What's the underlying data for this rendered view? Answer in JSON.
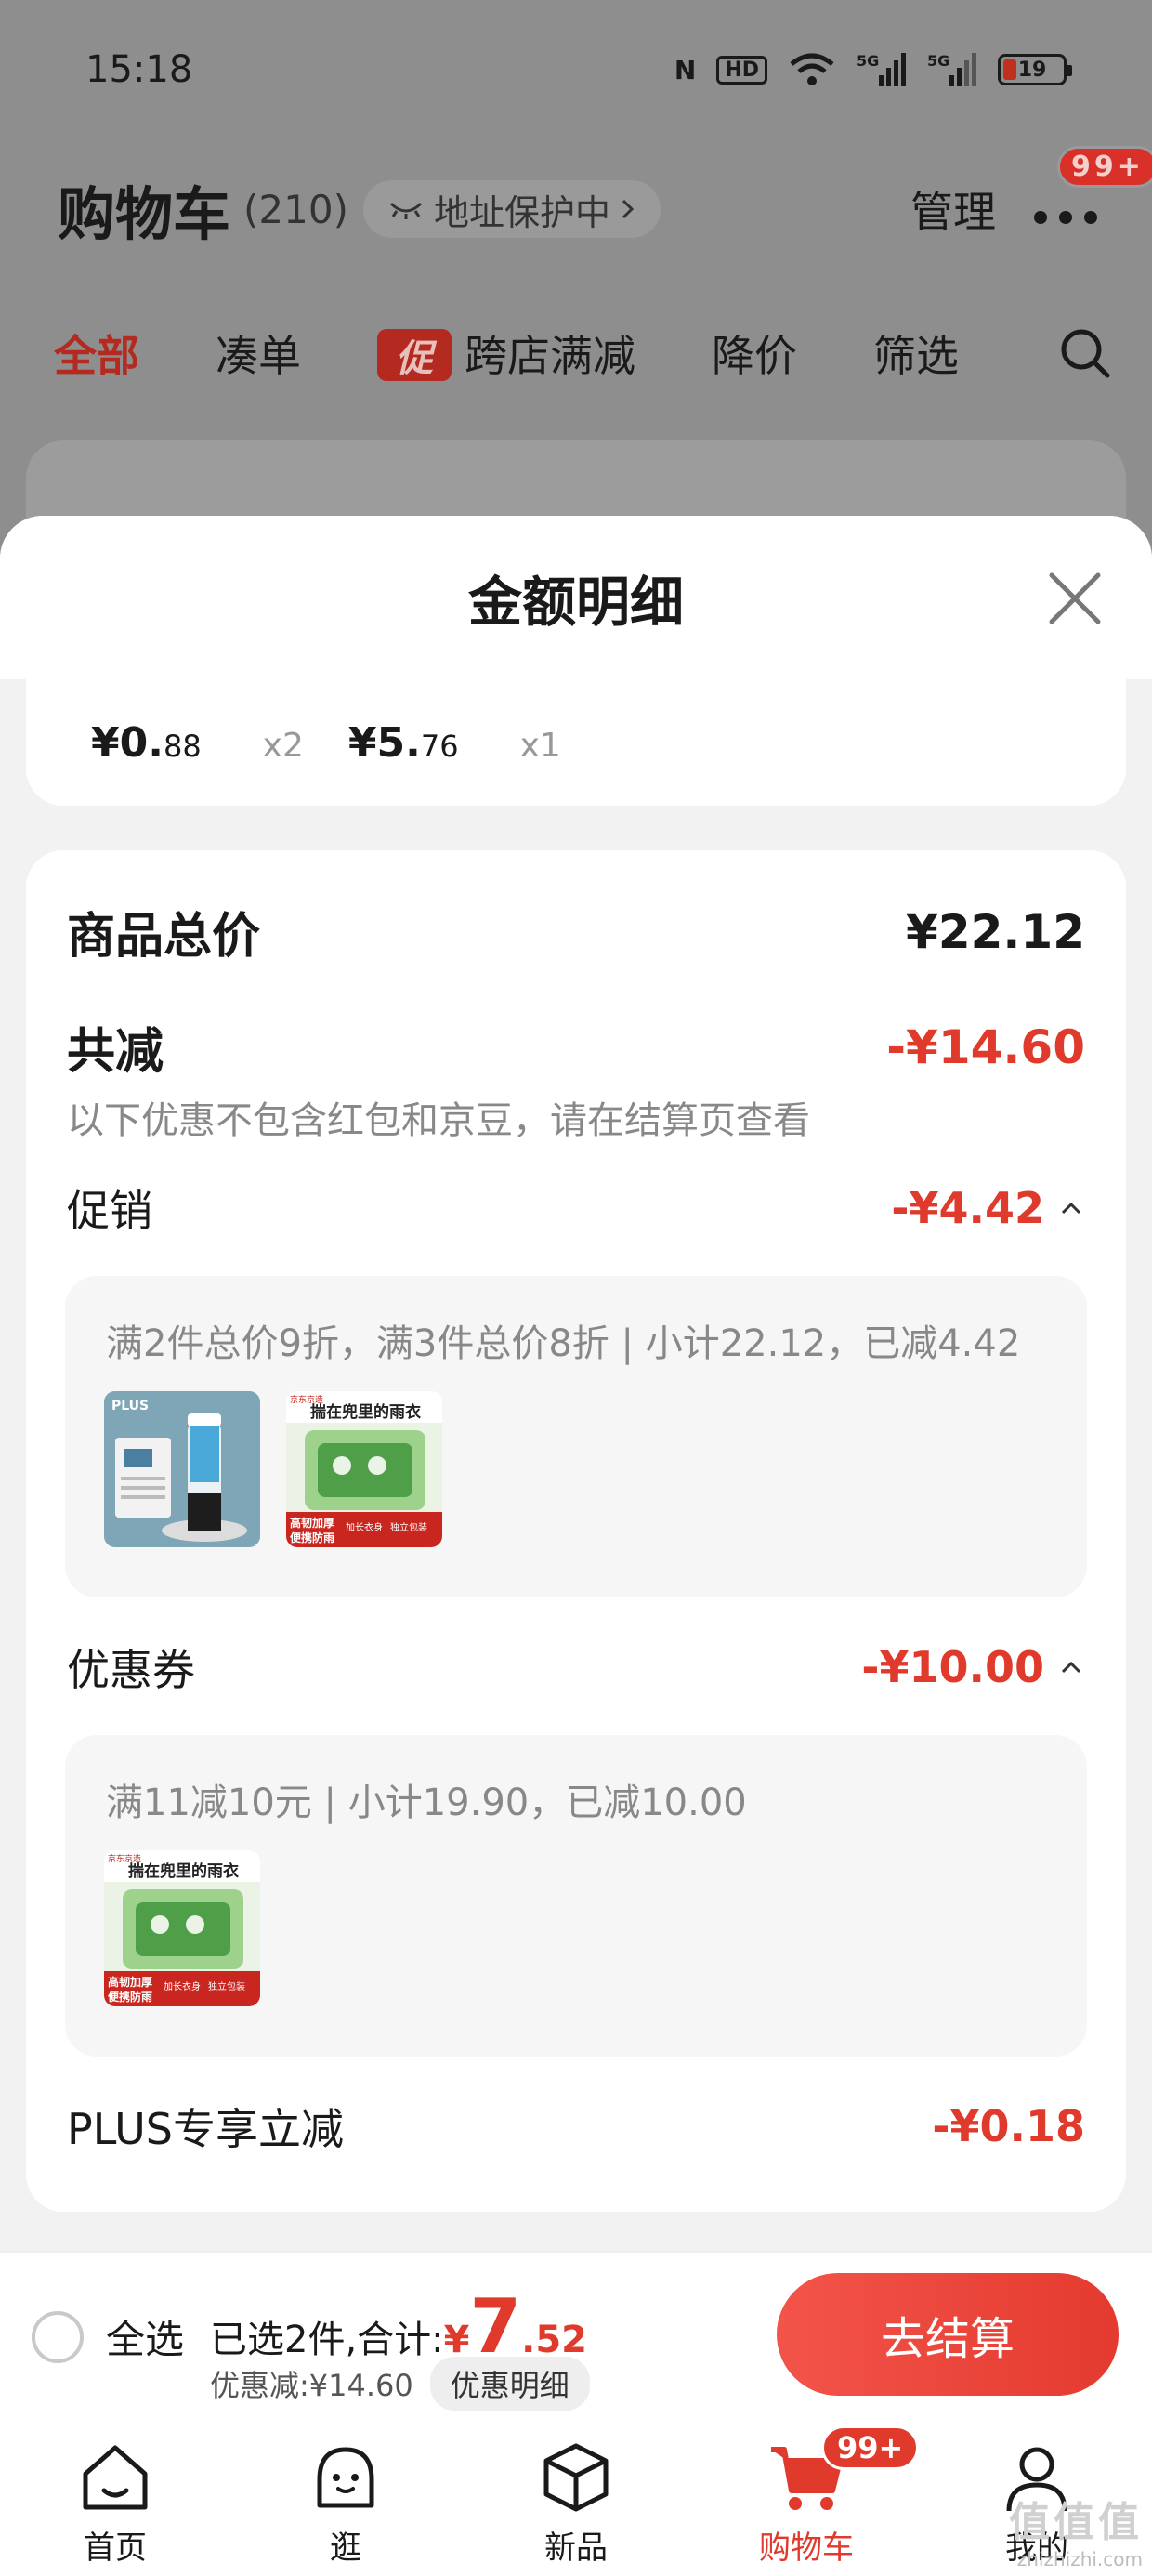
{
  "status_bar": {
    "time": "15:18",
    "battery": "19"
  },
  "cart_header": {
    "title": "购物车",
    "count": "(210)",
    "address_pill": "地址保护中",
    "manage": "管理",
    "more_badge": "99+"
  },
  "cart_tabs": [
    {
      "label": "全部",
      "active": true
    },
    {
      "label": "凑单"
    },
    {
      "label": "跨店满减",
      "tag": "促"
    },
    {
      "label": "降价"
    },
    {
      "label": "筛选"
    }
  ],
  "sheet": {
    "title": "金额明细",
    "price_strip": [
      {
        "price_int": "¥0.",
        "price_dec": "88",
        "qty": "x2"
      },
      {
        "price_int": "¥5.",
        "price_dec": "76",
        "qty": "x1"
      }
    ],
    "total_label": "商品总价",
    "total_value": "¥22.12",
    "reduce_label": "共减",
    "reduce_value": "-¥14.60",
    "reduce_note": "以下优惠不包含红包和京豆，请在结算页查看",
    "promo": {
      "label": "促销",
      "value": "-¥4.42",
      "detail": "满2件总价9折，满3件总价8折 | 小计22.12，已减4.42"
    },
    "coupon": {
      "label": "优惠券",
      "value": "-¥10.00",
      "detail": "满11减10元 | 小计19.90，已减10.00"
    },
    "plus": {
      "label": "PLUS专享立减",
      "value": "-¥0.18"
    },
    "product_texts": {
      "plus_brand": "PLUS",
      "raincoat_title": "揣在兜里的雨衣",
      "raincoat_tag1": "高韧加厚",
      "raincoat_tag2": "便携防雨",
      "raincoat_tag3": "加长衣身",
      "raincoat_tag4": "独立包装",
      "brand_small": "京东京造"
    }
  },
  "checkout": {
    "select_all": "全选",
    "selected_text": "已选2件,合计:",
    "sum_yen": "¥",
    "sum_int": "7",
    "sum_dec": ".52",
    "discount_text": "优惠减:¥14.60",
    "detail_pill": "优惠明细",
    "checkout_button": "去结算"
  },
  "bottom_nav": [
    {
      "label": "首页",
      "icon": "home-icon"
    },
    {
      "label": "逛",
      "icon": "browse-face-icon"
    },
    {
      "label": "新品",
      "icon": "box-icon"
    },
    {
      "label": "购物车",
      "icon": "cart-icon",
      "active": true,
      "badge": "99+"
    },
    {
      "label": "我的",
      "icon": "profile-icon"
    }
  ],
  "watermark": {
    "main": "值值值",
    "sub": "zhizhizhi.com"
  },
  "colors": {
    "accent_red": "#e03a2d",
    "sheet_bg": "#f2f2f2",
    "dim_bg": "#8e8e8e"
  }
}
